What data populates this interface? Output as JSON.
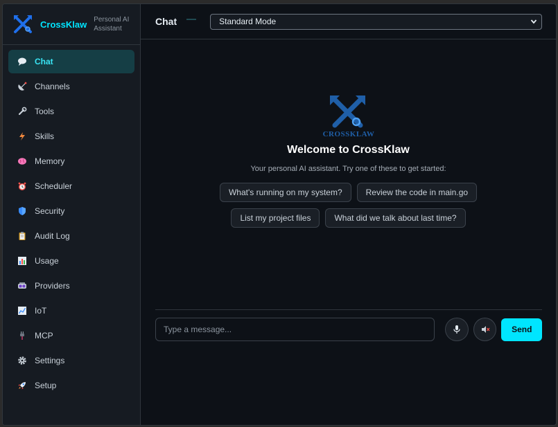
{
  "brand": {
    "name": "CrossKlaw",
    "tagline": "Personal AI Assistant",
    "logo_text": "CROSSKLAW"
  },
  "sidebar": {
    "items": [
      {
        "label": "Chat",
        "icon": "speech-bubble-icon",
        "active": true
      },
      {
        "label": "Channels",
        "icon": "satellite-dish-icon"
      },
      {
        "label": "Tools",
        "icon": "wrench-icon"
      },
      {
        "label": "Skills",
        "icon": "lightning-icon"
      },
      {
        "label": "Memory",
        "icon": "brain-icon"
      },
      {
        "label": "Scheduler",
        "icon": "alarm-clock-icon"
      },
      {
        "label": "Security",
        "icon": "shield-icon"
      },
      {
        "label": "Audit Log",
        "icon": "clipboard-icon"
      },
      {
        "label": "Usage",
        "icon": "bar-chart-icon"
      },
      {
        "label": "Providers",
        "icon": "vr-headset-icon"
      },
      {
        "label": "IoT",
        "icon": "line-chart-icon"
      },
      {
        "label": "MCP",
        "icon": "plug-icon"
      },
      {
        "label": "Settings",
        "icon": "gear-icon"
      },
      {
        "label": "Setup",
        "icon": "rocket-icon"
      }
    ]
  },
  "header": {
    "title": "Chat",
    "mode_selected": "Standard Mode"
  },
  "welcome": {
    "title": "Welcome to CrossKlaw",
    "subtitle": "Your personal AI assistant. Try one of these to get started:",
    "suggestions": [
      "What's running on my system?",
      "Review the code in main.go",
      "List my project files",
      "What did we talk about last time?"
    ]
  },
  "composer": {
    "placeholder": "Type a message...",
    "send_label": "Send"
  },
  "colors": {
    "accent": "#00e5ff",
    "active_bg": "#153e45",
    "background": "#0d1117",
    "sidebar_bg": "#161b22"
  }
}
